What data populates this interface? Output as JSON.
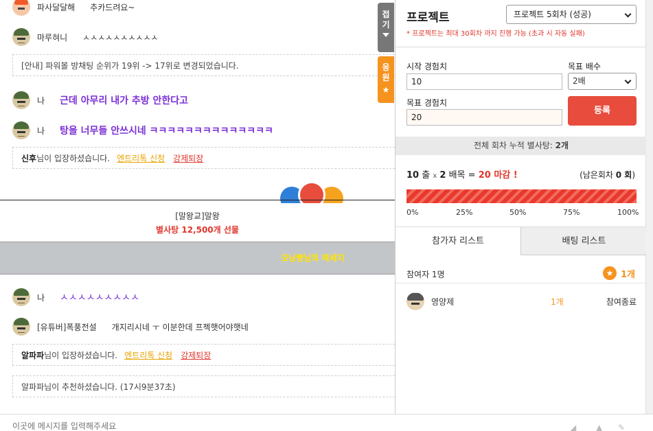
{
  "chat": {
    "messages": [
      {
        "nick": "파사달달해",
        "text": "추카드려요~"
      },
      {
        "nick": "마루혀니",
        "text": "ㅅㅅㅅㅅㅅㅅㅅㅅㅅㅅ"
      },
      {
        "notice": "[안내] 파워볼 방채팅 순위가 19위 -> 17위로 변경되었습니다."
      },
      {
        "nick": "나",
        "text": "근데 아무리 내가 추방 안한다고"
      },
      {
        "nick": "나",
        "text": "탕을 너무들 안쓰시네 ㅋㅋㅋㅋㅋㅋㅋㅋㅋㅋㅋㅋㅋㅋ"
      },
      {
        "user": "신후",
        "suffix": "님이 입장하셨습니다.",
        "link1": "엔트리톡 신청",
        "link2": "강제퇴장"
      },
      {
        "nick": "나",
        "text": "ㅅㅅㅅㅅㅅㅅㅅㅅㅅ"
      },
      {
        "nick": "[유튜버]폭풍전설",
        "text": "개지리시네 ㅜ 이분한데 프젝햇어야햇네"
      },
      {
        "user": "알파파",
        "suffix": "님이 입장하셨습니다.",
        "link1": "엔트리톡 신청",
        "link2": "강제퇴장"
      },
      {
        "notice": "알파파님이 추천하셨습니다. (17시9분37초)"
      }
    ],
    "gift": {
      "name": "[말왕교]말왕",
      "amount": "별사탕 12,500개 선물"
    },
    "banner": "모닝빵님의 메세지",
    "fold_label": [
      "접",
      "기"
    ],
    "cheer_label": [
      "응",
      "원"
    ],
    "input_placeholder": "이곳에 메시지를 입력해주세요"
  },
  "panel": {
    "title": "프로젝트",
    "project_select": "프로젝트 5회차 (성공)",
    "note": "* 프로젝트는 최대 30회차 까지 진행 가능 (초과 시 자동 실패)",
    "start_label": "시작 경험치",
    "start_value": "10",
    "multiplier_label": "목표 배수",
    "multiplier_value": "2배",
    "target_label": "목표 경험치",
    "target_value": "20",
    "register_label": "등록",
    "total_text": "전체 회차 누적 별사탕: ",
    "total_value": "2개",
    "calc": {
      "a": "10",
      "a_unit": "출",
      "x": "x",
      "b": "2",
      "b_unit": "배목",
      "eq": "=",
      "result": "20 마감 !"
    },
    "remain_text": "(남은회차 ",
    "remain_value": "0 회",
    "remain_close": ")",
    "progress_percent": 100,
    "ticks": [
      "0%",
      "25%",
      "50%",
      "75%",
      "100%"
    ],
    "tabs": [
      "참가자 리스트",
      "배팅 리스트"
    ],
    "participants_label": "참여자 1명",
    "participants_total": "1개",
    "participants": [
      {
        "name": "영양제",
        "amount": "1개",
        "status": "참여종료"
      }
    ]
  }
}
